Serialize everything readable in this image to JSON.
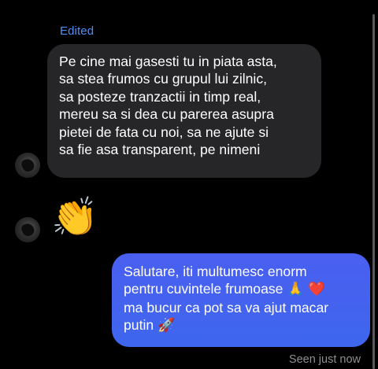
{
  "thread": {
    "edited_label": "Edited",
    "received_message": {
      "lines": [
        "Pe cine mai gasesti tu in piata asta,",
        "sa stea frumos cu grupul lui zilnic,",
        "sa posteze tranzactii in timp real,",
        "mereu sa si dea cu parerea asupra",
        "pietei de fata cu noi, sa ne ajute si",
        "sa fie asa transparent, pe nimeni"
      ]
    },
    "reaction_emoji": "👏",
    "sent_message": {
      "lines": [
        "Salutare, iti multumesc enorm",
        "pentru cuvintele frumoase",
        "ma bucur ca pot sa va ajut macar",
        "putin"
      ],
      "emoji_pray": "🙏",
      "emoji_heart": "❤️",
      "emoji_rocket": "🚀"
    },
    "seen_status": "Seen just now"
  },
  "colors": {
    "background": "#000000",
    "received_bubble": "#262629",
    "sent_bubble": "#4a5ff0",
    "edited_label": "#4f8ef7",
    "status_text": "#8e8e93"
  },
  "icons": {
    "avatar": "contact-avatar"
  }
}
